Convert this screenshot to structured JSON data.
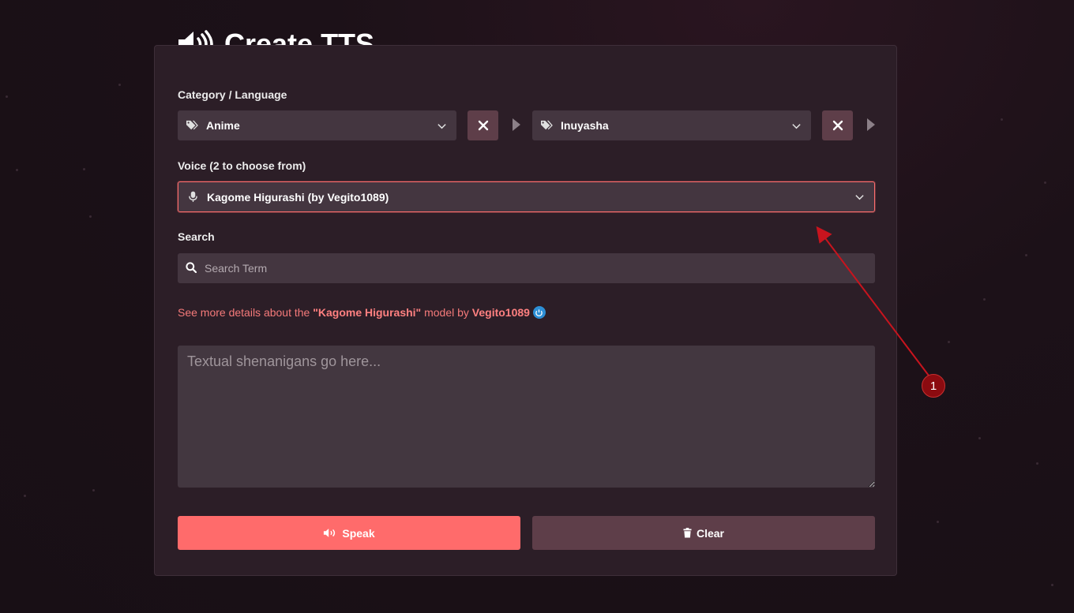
{
  "page": {
    "title": "Create TTS",
    "accent_color": "#ff6b6b",
    "icon": "volume-up-icon"
  },
  "category": {
    "label": "Category / Language",
    "first_select": {
      "value": "Anime",
      "icon": "tags-icon"
    },
    "second_select": {
      "value": "Inuyasha",
      "icon": "tags-icon"
    }
  },
  "voice": {
    "label": "Voice (2 to choose from)",
    "value": "Kagome Higurashi (by Vegito1089)",
    "icon": "microphone-icon"
  },
  "search": {
    "label": "Search",
    "placeholder": "Search Term"
  },
  "details": {
    "prefix": "See more details about the ",
    "model_name": "\"Kagome Higurashi\"",
    "middle": " model by ",
    "author": "Vegito1089"
  },
  "text_input": {
    "placeholder": "Textual shenanigans go here..."
  },
  "actions": {
    "speak_label": "Speak",
    "clear_label": "Clear"
  },
  "annotation": {
    "badge_number": "1",
    "color": "#c8141e"
  }
}
